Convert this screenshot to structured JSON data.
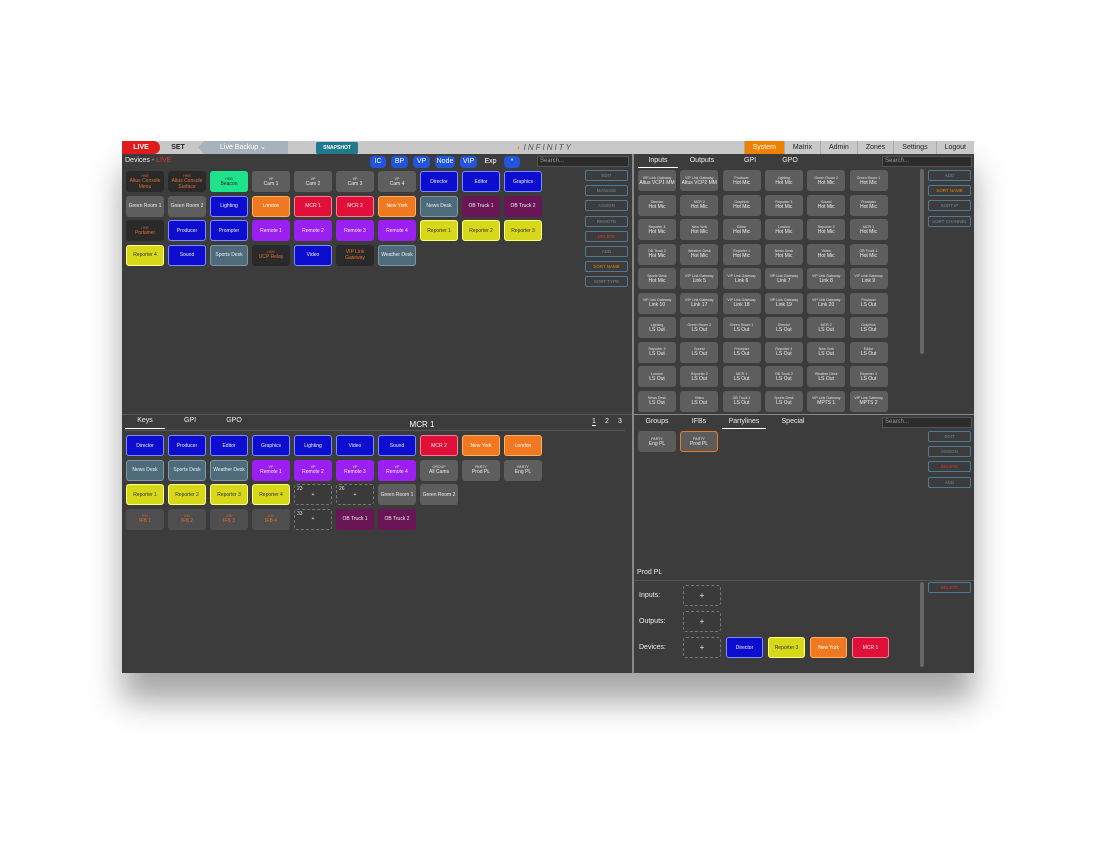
{
  "topbar": {
    "live": "LIVE",
    "set": "SET",
    "backup": "Live Backup",
    "snapshot": "SNAPSHOT",
    "brand": "INFINITY",
    "nav": [
      "System",
      "Matrix",
      "Admin",
      "Zones",
      "Settings",
      "Logout"
    ]
  },
  "devices": {
    "title": "Devices - ",
    "title_live": "LIVE",
    "filters": [
      "IC",
      "BP",
      "VP",
      "Node",
      "VIP",
      "Exp",
      "*"
    ],
    "search_placeholder": "Search...",
    "buttons": [
      "EDIT",
      "MANAGE",
      "ASSIGN",
      "REMOTE",
      "DELETE",
      "ADD",
      "SORT NAME",
      "SORT TYPE"
    ],
    "keys": [
      {
        "sub": "HKB",
        "label": "Altus Console Menu",
        "style": "dark"
      },
      {
        "sub": "HKB",
        "label": "Altus Console Surface",
        "style": "dark"
      },
      {
        "sub": "HKB",
        "label": "Beacon",
        "style": "cyan"
      },
      {
        "sub": "VP",
        "label": "Cam 1",
        "style": "gray"
      },
      {
        "sub": "VP",
        "label": "Cam 2",
        "style": "gray"
      },
      {
        "sub": "VP",
        "label": "Cam 3",
        "style": "gray"
      },
      {
        "sub": "VP",
        "label": "Cam 4",
        "style": "gray"
      },
      {
        "sub": "",
        "label": "Director",
        "style": "blue"
      },
      {
        "sub": "",
        "label": "Editor",
        "style": "blue"
      },
      {
        "sub": "",
        "label": "Graphics",
        "style": "blue"
      },
      {
        "sub": "",
        "label": "Green Room 1",
        "style": "gray"
      },
      {
        "sub": "",
        "label": "Green Room 2",
        "style": "gray"
      },
      {
        "sub": "",
        "label": "Lighting",
        "style": "blue"
      },
      {
        "sub": "",
        "label": "London",
        "style": "orange"
      },
      {
        "sub": "",
        "label": "MCR 1",
        "style": "red"
      },
      {
        "sub": "",
        "label": "MCR 2",
        "style": "red"
      },
      {
        "sub": "",
        "label": "New York",
        "style": "orange"
      },
      {
        "sub": "",
        "label": "News Desk",
        "style": "slate"
      },
      {
        "sub": "",
        "label": "OB Truck 1",
        "style": "maroon"
      },
      {
        "sub": "",
        "label": "OB Truck 2",
        "style": "maroon"
      },
      {
        "sub": "HKB",
        "label": "Portainer",
        "style": "dark"
      },
      {
        "sub": "",
        "label": "Producer",
        "style": "blue"
      },
      {
        "sub": "",
        "label": "Prompter",
        "style": "blue"
      },
      {
        "sub": "",
        "label": "Remote 1",
        "style": "purple"
      },
      {
        "sub": "",
        "label": "Remote 2",
        "style": "purple"
      },
      {
        "sub": "",
        "label": "Remote 3",
        "style": "purple"
      },
      {
        "sub": "",
        "label": "Remote 4",
        "style": "purple"
      },
      {
        "sub": "",
        "label": "Reporter 1",
        "style": "yellow"
      },
      {
        "sub": "",
        "label": "Reporter 2",
        "style": "yellow"
      },
      {
        "sub": "",
        "label": "Reporter 3",
        "style": "yellow"
      },
      {
        "sub": "",
        "label": "Reporter 4",
        "style": "yellow"
      },
      {
        "sub": "",
        "label": "Sound",
        "style": "blue"
      },
      {
        "sub": "",
        "label": "Sports Desk",
        "style": "slate"
      },
      {
        "sub": "HKB",
        "label": "UCP Relay",
        "style": "dark"
      },
      {
        "sub": "",
        "label": "Video",
        "style": "blue"
      },
      {
        "sub": "",
        "label": "VIP Link Gateway",
        "style": "dark"
      },
      {
        "sub": "",
        "label": "Weather Desk",
        "style": "slate"
      }
    ]
  },
  "keys_panel": {
    "tabs": [
      "Keys",
      "GPI",
      "GPO"
    ],
    "title": "MCR 1",
    "pages": [
      "1",
      "2",
      "3"
    ],
    "keys": [
      {
        "sub": "",
        "label": "Director",
        "style": "blue"
      },
      {
        "sub": "",
        "label": "Producer",
        "style": "blue"
      },
      {
        "sub": "",
        "label": "Editor",
        "style": "blue"
      },
      {
        "sub": "",
        "label": "Graphics",
        "style": "blue"
      },
      {
        "sub": "",
        "label": "Lighting",
        "style": "blue"
      },
      {
        "sub": "",
        "label": "Video",
        "style": "blue"
      },
      {
        "sub": "",
        "label": "Sound",
        "style": "blue"
      },
      {
        "sub": "",
        "label": "MCR 2",
        "style": "red"
      },
      {
        "sub": "",
        "label": "New York",
        "style": "orange"
      },
      {
        "sub": "",
        "label": "London",
        "style": "orange"
      },
      {
        "sub": "",
        "label": "News Desk",
        "style": "slate"
      },
      {
        "sub": "",
        "label": "Sports Desk",
        "style": "slate"
      },
      {
        "sub": "",
        "label": "Weather Desk",
        "style": "slate"
      },
      {
        "sub": "VP",
        "label": "Remote 1",
        "style": "purple"
      },
      {
        "sub": "VP",
        "label": "Remote 2",
        "style": "purple"
      },
      {
        "sub": "VP",
        "label": "Remote 3",
        "style": "purple"
      },
      {
        "sub": "VP",
        "label": "Remote 4",
        "style": "purple"
      },
      {
        "sub": "GROUP",
        "label": "All Cams",
        "style": "gray"
      },
      {
        "sub": "PARTY",
        "label": "Prod PL",
        "style": "gray"
      },
      {
        "sub": "PARTY",
        "label": "Eng PL",
        "style": "gray"
      },
      {
        "sub": "",
        "label": "Reporter 1",
        "style": "yellow"
      },
      {
        "sub": "",
        "label": "Reporter 2",
        "style": "yellow"
      },
      {
        "sub": "",
        "label": "Reporter 3",
        "style": "yellow"
      },
      {
        "sub": "",
        "label": "Reporter 4",
        "style": "yellow"
      },
      {
        "sub": "23",
        "label": "+",
        "style": "empty"
      },
      {
        "sub": "26",
        "label": "+",
        "style": "empty"
      },
      {
        "sub": "",
        "label": "Green Room 1",
        "style": "gray"
      },
      {
        "sub": "",
        "label": "Green Room 2",
        "style": "gray"
      },
      {
        "sub": "",
        "label": "",
        "style": "none"
      },
      {
        "sub": "",
        "label": "",
        "style": "none"
      },
      {
        "sub": "IFB",
        "label": "IFB 1",
        "style": "darkgray"
      },
      {
        "sub": "IFB",
        "label": "IFB 2",
        "style": "darkgray"
      },
      {
        "sub": "IFB",
        "label": "IFB 3",
        "style": "darkgray"
      },
      {
        "sub": "IFB",
        "label": "IFB 4",
        "style": "darkgray"
      },
      {
        "sub": "33",
        "label": "+",
        "style": "empty"
      },
      {
        "sub": "",
        "label": "OB Truck 1",
        "style": "maroon"
      },
      {
        "sub": "",
        "label": "OB Truck 2",
        "style": "maroon"
      }
    ]
  },
  "io_panel": {
    "tabs": [
      "Inputs",
      "Outputs",
      "GPI",
      "GPO"
    ],
    "search_placeholder": "Search...",
    "buttons": [
      "ADD",
      "SORT NAME",
      "SORT IP",
      "SORT CHANNEL"
    ],
    "cells": [
      {
        "sub": "VIP Link Gateway",
        "label": "Altus VCP1 MM"
      },
      {
        "sub": "VIP Link Gateway",
        "label": "Altus VCP2 MM"
      },
      {
        "sub": "Producer",
        "label": "Hot Mic"
      },
      {
        "sub": "Lighting",
        "label": "Hot Mic"
      },
      {
        "sub": "Green Room 2",
        "label": "Hot Mic"
      },
      {
        "sub": "Green Room 1",
        "label": "Hot Mic"
      },
      {
        "sub": "Director",
        "label": "Hot Mic"
      },
      {
        "sub": "MCR 2",
        "label": "Hot Mic"
      },
      {
        "sub": "Graphics",
        "label": "Hot Mic"
      },
      {
        "sub": "Reporter 3",
        "label": "Hot Mic"
      },
      {
        "sub": "Sound",
        "label": "Hot Mic"
      },
      {
        "sub": "Prompter",
        "label": "Hot Mic"
      },
      {
        "sub": "Reporter 4",
        "label": "Hot Mic"
      },
      {
        "sub": "New York",
        "label": "Hot Mic"
      },
      {
        "sub": "Editor",
        "label": "Hot Mic"
      },
      {
        "sub": "London",
        "label": "Hot Mic"
      },
      {
        "sub": "Reporter 2",
        "label": "Hot Mic"
      },
      {
        "sub": "MCR 1",
        "label": "Hot Mic"
      },
      {
        "sub": "OB Truck 2",
        "label": "Hot Mic"
      },
      {
        "sub": "Weather Desk",
        "label": "Hot Mic"
      },
      {
        "sub": "Reporter 1",
        "label": "Hot Mic"
      },
      {
        "sub": "News Desk",
        "label": "Hot Mic"
      },
      {
        "sub": "Video",
        "label": "Hot Mic"
      },
      {
        "sub": "OB Truck 1",
        "label": "Hot Mic"
      },
      {
        "sub": "Sports Desk",
        "label": "Hot Mic"
      },
      {
        "sub": "VIP Link Gateway",
        "label": "Link 5"
      },
      {
        "sub": "VIP Link Gateway",
        "label": "Link 6"
      },
      {
        "sub": "VIP Link Gateway",
        "label": "Link 7"
      },
      {
        "sub": "VIP Link Gateway",
        "label": "Link 8"
      },
      {
        "sub": "VIP Link Gateway",
        "label": "Link 9"
      },
      {
        "sub": "VIP Link Gateway",
        "label": "Link 10"
      },
      {
        "sub": "VIP Link Gateway",
        "label": "Link 17"
      },
      {
        "sub": "VIP Link Gateway",
        "label": "Link 18"
      },
      {
        "sub": "VIP Link Gateway",
        "label": "Link 19"
      },
      {
        "sub": "VIP Link Gateway",
        "label": "Link 20"
      },
      {
        "sub": "Producer",
        "label": "LS Out"
      },
      {
        "sub": "Lighting",
        "label": "LS Out"
      },
      {
        "sub": "Green Room 2",
        "label": "LS Out"
      },
      {
        "sub": "Green Room 1",
        "label": "LS Out"
      },
      {
        "sub": "Director",
        "label": "LS Out"
      },
      {
        "sub": "MCR 2",
        "label": "LS Out"
      },
      {
        "sub": "Graphics",
        "label": "LS Out"
      },
      {
        "sub": "Reporter 3",
        "label": "LS Out"
      },
      {
        "sub": "Sound",
        "label": "LS Out"
      },
      {
        "sub": "Prompter",
        "label": "LS Out"
      },
      {
        "sub": "Reporter 4",
        "label": "LS Out"
      },
      {
        "sub": "New York",
        "label": "LS Out"
      },
      {
        "sub": "Editor",
        "label": "LS Out"
      },
      {
        "sub": "London",
        "label": "LS Out"
      },
      {
        "sub": "Reporter 2",
        "label": "LS Out"
      },
      {
        "sub": "MCR 1",
        "label": "LS Out"
      },
      {
        "sub": "OB Truck 2",
        "label": "LS Out"
      },
      {
        "sub": "Weather Desk",
        "label": "LS Out"
      },
      {
        "sub": "Reporter 1",
        "label": "LS Out"
      },
      {
        "sub": "News Desk",
        "label": "LS Out"
      },
      {
        "sub": "Video",
        "label": "LS Out"
      },
      {
        "sub": "OB Truck 1",
        "label": "LS Out"
      },
      {
        "sub": "Sports Desk",
        "label": "LS Out"
      },
      {
        "sub": "VIP Link Gateway",
        "label": "MPTS 1"
      },
      {
        "sub": "VIP Link Gateway",
        "label": "MPTS 2"
      }
    ]
  },
  "groups_panel": {
    "tabs": [
      "Groups",
      "IFBs",
      "Partylines",
      "Special"
    ],
    "search_placeholder": "Search...",
    "buttons": [
      "EDIT",
      "ASSIGN",
      "DELETE",
      "ADD"
    ],
    "partylines": [
      {
        "sub": "PARTY",
        "label": "Eng PL"
      },
      {
        "sub": "PARTY",
        "label": "Prod PL"
      }
    ]
  },
  "detail_panel": {
    "title": "Prod PL",
    "delete": "DELETE",
    "rows": [
      "Inputs:",
      "Outputs:",
      "Devices:"
    ],
    "plus": "+",
    "devices": [
      {
        "label": "Director",
        "style": "blue"
      },
      {
        "label": "Reporter 3",
        "style": "yellow"
      },
      {
        "label": "New York",
        "style": "orange"
      },
      {
        "label": "MCR 1",
        "style": "red"
      }
    ]
  }
}
